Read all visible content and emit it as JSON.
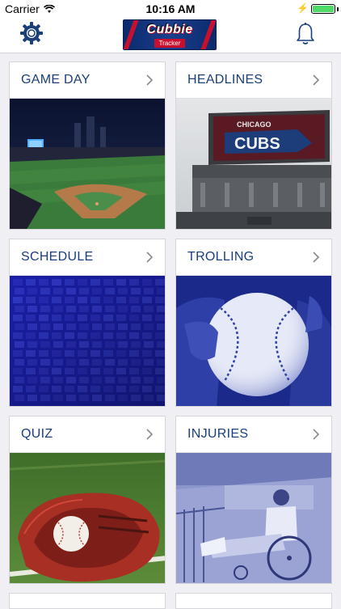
{
  "status_bar": {
    "carrier": "Carrier",
    "time": "10:16 AM",
    "battery_percent": 100
  },
  "header": {
    "logo_name": "Cubbie",
    "logo_sub": "Tracker",
    "left_icon": "gear-icon",
    "right_icon": "bell-icon"
  },
  "tiles": [
    {
      "label": "GAME DAY",
      "image": "night-ballpark-aerial-photo"
    },
    {
      "label": "HEADLINES",
      "image": "wrigley-marquee-photo"
    },
    {
      "label": "SCHEDULE",
      "image": "scoreboard-blue-tint-photo"
    },
    {
      "label": "TROLLING",
      "image": "hand-holding-baseball-blue-tint-photo"
    },
    {
      "label": "QUIZ",
      "image": "catchers-mitt-with-ball-photo"
    },
    {
      "label": "INJURIES",
      "image": "man-in-wheelchair-vintage-photo"
    }
  ],
  "colors": {
    "accent_blue": "#1a3f7a",
    "brand_red": "#c8102e",
    "background": "#efeff4"
  }
}
